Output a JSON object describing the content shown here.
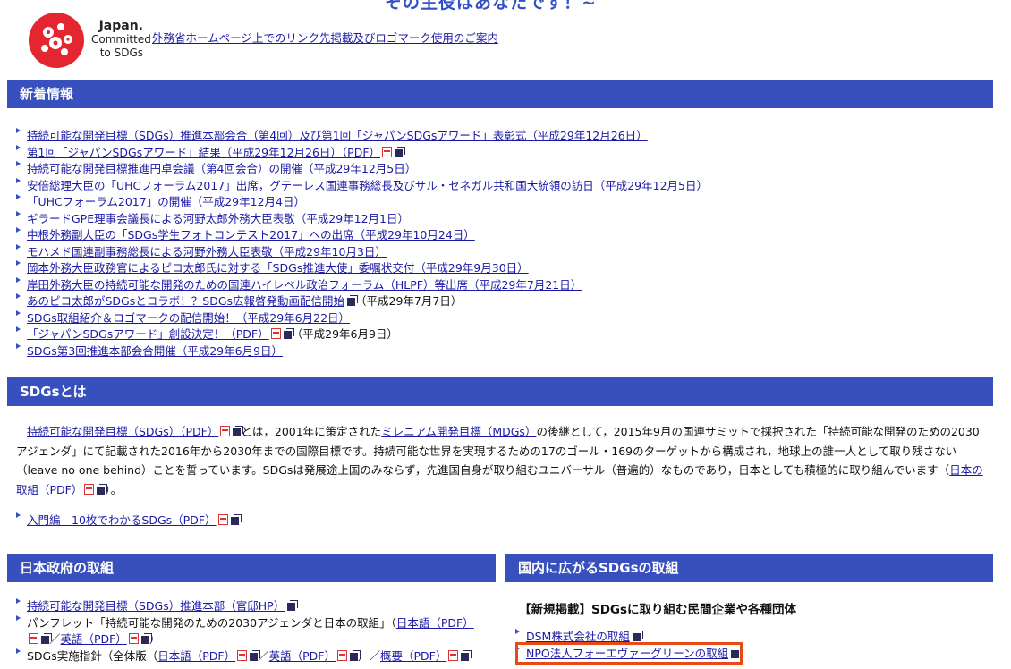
{
  "top_heading_partial": "その主役はあなたです！~",
  "logo": {
    "line1": "Japan.",
    "line2": "Committed",
    "line3": "to SDGs"
  },
  "logo_link": "外務省ホームページ上でのリンク先掲載及びロゴマーク使用のご案内",
  "news": {
    "title": "新着情報",
    "items": [
      {
        "text": "持続可能な開発目標（SDGs）推進本部会合（第4回）及び第1回「ジャパンSDGsアワード」表彰式（平成29年12月26日）"
      },
      {
        "text": "第1回「ジャパンSDGsアワード」結果（平成29年12月26日）（PDF）"
      },
      {
        "text": "持続可能な開発目標推進円卓会議（第4回会合）の開催（平成29年12月5日）"
      },
      {
        "text": "安倍総理大臣の「UHCフォーラム2017」出席，グテーレス国連事務総長及びサル・セネガル共和国大統領の訪日（平成29年12月5日）"
      },
      {
        "text": "「UHCフォーラム2017」の開催（平成29年12月4日）"
      },
      {
        "text": "ギラードGPE理事会議長による河野太郎外務大臣表敬（平成29年12月1日）"
      },
      {
        "text": "中根外務副大臣の「SDGs学生フォトコンテスト2017」への出席（平成29年10月24日）"
      },
      {
        "text": "モハメド国連副事務総長による河野外務大臣表敬（平成29年10月3日）"
      },
      {
        "text": "岡本外務大臣政務官によるピコ太郎氏に対する「SDGs推進大使」委嘱状交付（平成29年9月30日）"
      },
      {
        "text": "岸田外務大臣の持続可能な開発のための国連ハイレベル政治フォーラム（HLPF）等出席（平成29年7月21日）"
      },
      {
        "text": "あのピコ太郎がSDGsとコラボ！？SDGs広報啓発動画配信開始",
        "tail": "（平成29年7月7日）"
      },
      {
        "text": "SDGs取組紹介＆ロゴマークの配信開始！（平成29年6月22日）"
      },
      {
        "text": "「ジャパンSDGsアワード」創設決定！（PDF）",
        "tail": "（平成29年6月9日）"
      },
      {
        "text": "SDGs第3回推進本部会合開催（平成29年6月9日）"
      }
    ]
  },
  "about": {
    "title": "SDGsとは",
    "link1": "持続可能な開発目標（SDGs）（PDF）",
    "t1": "とは，2001年に策定された",
    "link2": "ミレニアム開発目標（MDGs）",
    "t2": "の後継として，2015年9月の国連サミットで採択された「持続可能な開発のための2030アジェンダ」にて記載された2016年から2030年までの国際目標です。持続可能な世界を実現するための17のゴール・169のターゲットから構成され，地球上の誰一人として取り残さない（leave no one behind）ことを誓っています。SDGsは発展途上国のみならず，先進国自身が取り組むユニバーサル（普遍的）なものであり，日本としても積極的に取り組んでいます（",
    "link3": "日本の取組（PDF）",
    "t3": "）。",
    "intro_link": "入門編　10枚でわかるSDGs（PDF）"
  },
  "gov": {
    "title": "日本政府の取組",
    "i1": "持続可能な開発目標（SDGs）推進本部（官邸HP）",
    "i2_pre": "パンフレット「持続可能な開発のための2030アジェンダと日本の取組」（",
    "i2_l1": "日本語（PDF）",
    "i2_sep": "／",
    "i2_l2": "英語（PDF）",
    "i2_post": "）",
    "i3_pre": "SDGs実施指針（全体版（",
    "i3_l1": "日本語（PDF）",
    "i3_s1": "／",
    "i3_l2": "英語（PDF）",
    "i3_mid": "）／",
    "i3_l3": "概要（PDF）"
  },
  "domestic": {
    "title": "国内に広がるSDGsの取組",
    "subheading": "【新規掲載】SDGsに取り組む民間企業や各種団体",
    "items": [
      "DSM株式会社の取組",
      "NPO法人フォーエヴァーグリーンの取組"
    ]
  },
  "colors": {
    "header_bg": "#3750be",
    "link": "#1a1aa6",
    "highlight": "#e84a17",
    "logo_red": "#e3262f"
  }
}
